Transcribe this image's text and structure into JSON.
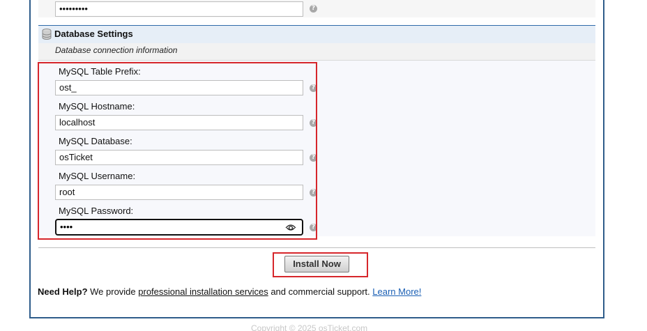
{
  "previous_field": {
    "value": "•••••••••"
  },
  "section": {
    "title": "Database Settings",
    "subtitle": "Database connection information",
    "icon": "database-icon"
  },
  "fields": [
    {
      "label": "MySQL Table Prefix:",
      "value": "ost_"
    },
    {
      "label": "MySQL Hostname:",
      "value": "localhost"
    },
    {
      "label": "MySQL Database:",
      "value": "osTicket"
    },
    {
      "label": "MySQL Username:",
      "value": "root"
    },
    {
      "label": "MySQL Password:",
      "value": "••••"
    }
  ],
  "help_icon_glyph": "?",
  "install_button": {
    "label": "Install Now"
  },
  "help": {
    "bold": "Need Help?",
    "text1": " We provide ",
    "link1": "professional installation services",
    "text2": " and commercial support. ",
    "link2": "Learn More!"
  },
  "footer": {
    "text": "Copyright © 2025 osTicket.com"
  },
  "colors": {
    "border_blue": "#2e5c8a",
    "highlight_red": "#d6262b",
    "link_blue": "#1a5fb4"
  }
}
